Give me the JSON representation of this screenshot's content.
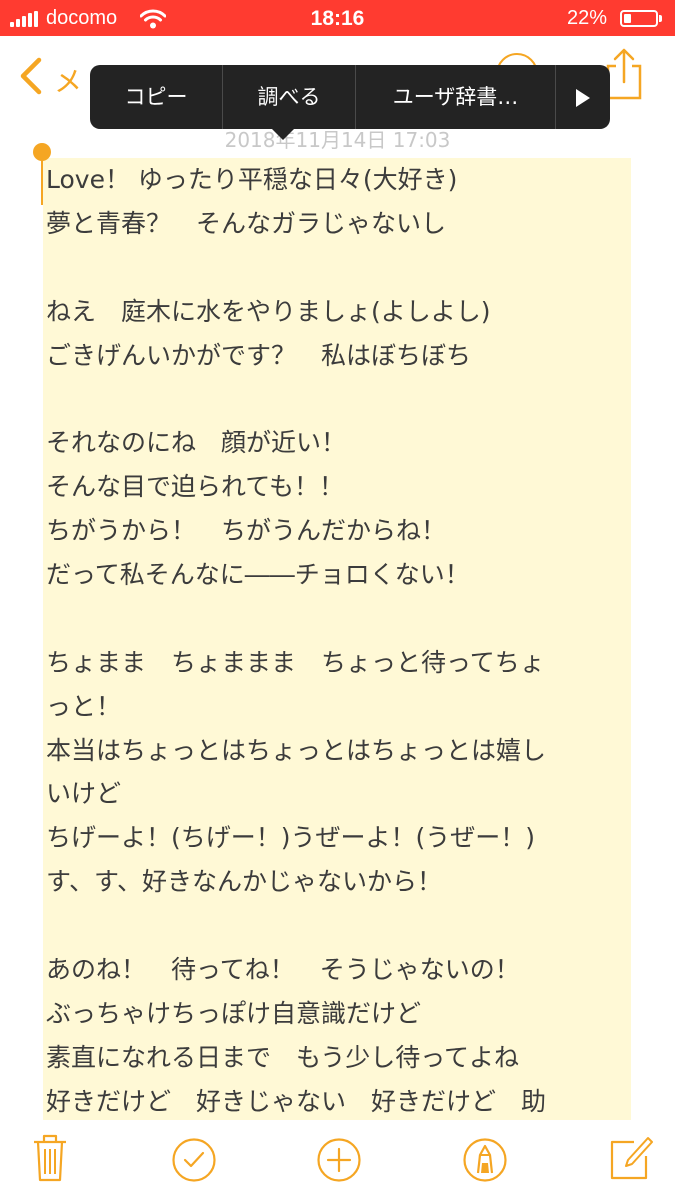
{
  "status_bar": {
    "carrier": "docomo",
    "time": "18:16",
    "battery_percent": "22%",
    "battery_level": 0.22,
    "background_color": "#ff3b30"
  },
  "nav": {
    "back_label": "メ",
    "back_icon": "chevron-left-icon",
    "person_icon": "person-add-icon",
    "share_icon": "share-icon",
    "accent_color": "#f5a623"
  },
  "edit_menu": {
    "items": [
      "コピー",
      "調べる",
      "ユーザ辞書…"
    ],
    "more_icon": "play-arrow-icon"
  },
  "note": {
    "date": "2018年11月14日 17:03",
    "lines": [
      "Love！ ゆったり平穏な日々(大好き)",
      "夢と青春？　そんなガラじゃないし",
      "",
      "ねえ　庭木に水をやりましょ(よしよし)",
      "ごきげんいかがです？　私はぼちぼち",
      "",
      "それなのにね　顔が近い！",
      "そんな目で迫られても！！",
      "ちがうから！　ちがうんだからね！",
      "だって私そんなに――チョロくない！",
      "",
      "ちょまま　ちょままま　ちょっと待ってちょ",
      "っと！",
      "本当はちょっとはちょっとはちょっとは嬉し",
      "いけど",
      "ちげーよ！(ちげー！)うぜーよ！(うぜー！)",
      "す、す、好きなんかじゃないから！",
      "",
      "あのね！　待ってね！　そうじゃないの！",
      "ぶっちゃけちっぽけ自意識だけど",
      "素直になれる日まで　もう少し待ってよね",
      "好きだけど　好きじゃない　好きだけど　助"
    ],
    "highlight_color": "#fff9d6"
  },
  "toolbar": {
    "icons": [
      "trash-icon",
      "checklist-icon",
      "add-icon",
      "markup-pen-icon",
      "compose-icon"
    ]
  }
}
